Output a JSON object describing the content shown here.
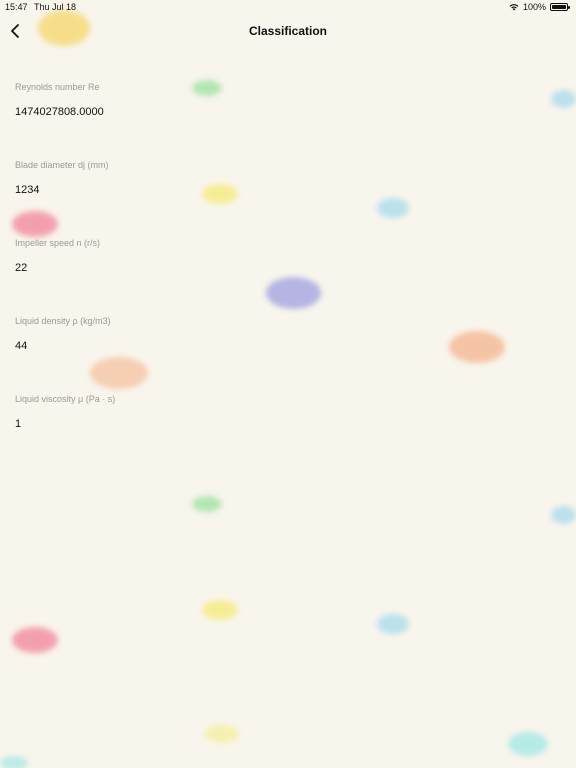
{
  "status_bar": {
    "time": "15:47",
    "date": "Thu Jul 18",
    "battery": "100%"
  },
  "nav": {
    "title": "Classification",
    "back_icon": "chevron-left-icon"
  },
  "fields": [
    {
      "label": "Reynolds number Re",
      "value": "1474027808.0000"
    },
    {
      "label": "Blade diameter dj (mm)",
      "value": "1234"
    },
    {
      "label": "Impeller speed n (r/s)",
      "value": "22"
    },
    {
      "label": "Liquid density ρ (kg/m3)",
      "value": "44"
    },
    {
      "label": "Liquid viscosity μ (Pa · s)",
      "value": "1"
    }
  ],
  "colors": {
    "background": "#f8f5ec",
    "text": "#111111",
    "label": "#999999"
  }
}
